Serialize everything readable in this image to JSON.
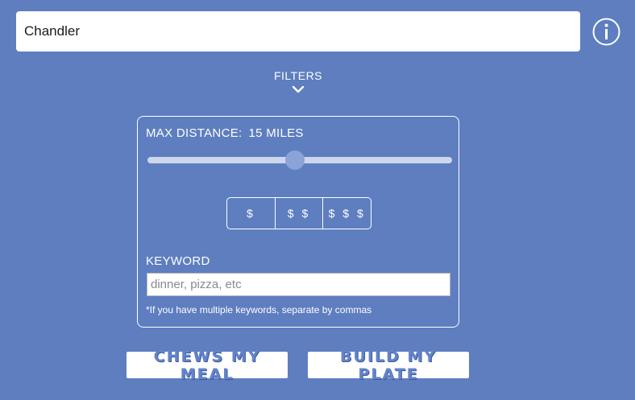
{
  "search": {
    "location_value": "Chandler"
  },
  "filters": {
    "toggle_label": "FILTERS",
    "max_distance_label": "MAX DISTANCE:",
    "max_distance_value": "15 MILES",
    "distance_fraction": 0.485,
    "price_options": [
      "$",
      "$ $",
      "$ $ $"
    ],
    "keyword_label": "KEYWORD",
    "keyword_placeholder": "dinner, pizza, etc",
    "keyword_hint": "*If you have multiple keywords, separate by commas"
  },
  "actions": {
    "chews_label": "CHEWS MY MEAL",
    "build_label": "BUILD MY PLATE"
  },
  "icons": {
    "info": "info-icon",
    "filters_toggle": "chevron-down-icon"
  },
  "colors": {
    "background": "#5e7ec0",
    "accent_text": "#6484c8",
    "slider_track": "#cdd7ec",
    "slider_thumb": "#8aa4d8"
  }
}
